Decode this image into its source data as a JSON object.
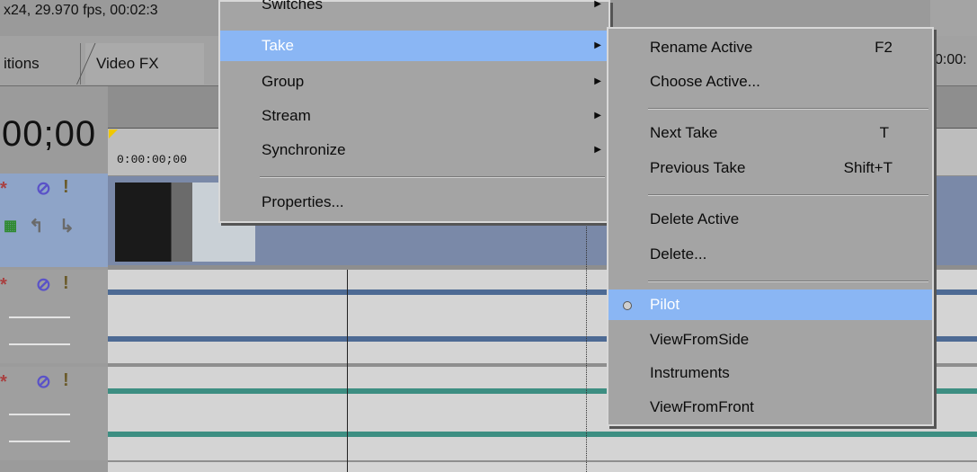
{
  "info_bar": {
    "text": "x24, 29.970 fps, 00:02:3"
  },
  "tabs": [
    {
      "label": "itions"
    },
    {
      "label": "Video FX"
    }
  ],
  "timeline": {
    "cursor_timecode": "00;00",
    "ruler_start": "0:00:00;00",
    "right_timecode": "0:00:"
  },
  "context_menu": {
    "items": [
      {
        "label": "Switches"
      },
      {
        "label": "Take"
      },
      {
        "label": "Group"
      },
      {
        "label": "Stream"
      },
      {
        "label": "Synchronize"
      },
      {
        "label": "Properties..."
      }
    ]
  },
  "take_submenu": {
    "items": [
      {
        "label": "Rename Active",
        "shortcut": "F2"
      },
      {
        "label": "Choose Active..."
      },
      {
        "label": "Next Take",
        "shortcut": "T"
      },
      {
        "label": "Previous Take",
        "shortcut": "Shift+T"
      },
      {
        "label": "Delete Active"
      },
      {
        "label": "Delete..."
      },
      {
        "label": "Pilot"
      },
      {
        "label": "ViewFromSide"
      },
      {
        "label": "Instruments"
      },
      {
        "label": "ViewFromFront"
      }
    ]
  },
  "colors": {
    "menu_highlight": "#8ab6f4",
    "video_track": "#7a89a8",
    "audio_wave_1": "#4d6a94",
    "audio_wave_2": "#3d8e82"
  },
  "icons": [
    "mute-icon",
    "solo-icon",
    "star-icon",
    "submenu-arrow-icon",
    "radio-dot-icon"
  ]
}
